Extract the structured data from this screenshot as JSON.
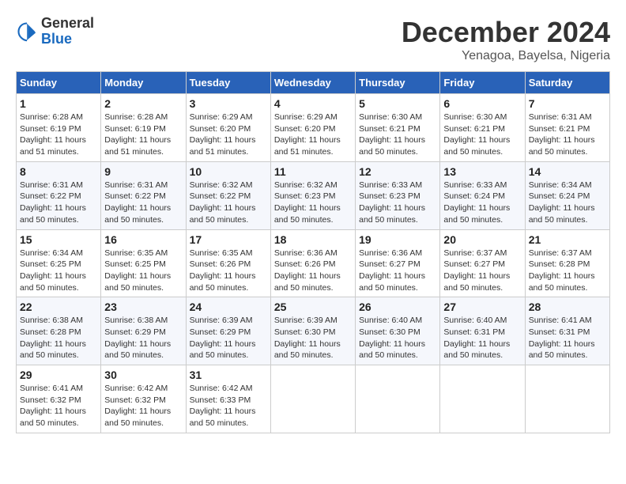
{
  "logo": {
    "general": "General",
    "blue": "Blue"
  },
  "title": "December 2024",
  "subtitle": "Yenagoa, Bayelsa, Nigeria",
  "days_of_week": [
    "Sunday",
    "Monday",
    "Tuesday",
    "Wednesday",
    "Thursday",
    "Friday",
    "Saturday"
  ],
  "weeks": [
    [
      {
        "day": "1",
        "sunrise": "6:28 AM",
        "sunset": "6:19 PM",
        "daylight": "11 hours and 51 minutes."
      },
      {
        "day": "2",
        "sunrise": "6:28 AM",
        "sunset": "6:19 PM",
        "daylight": "11 hours and 51 minutes."
      },
      {
        "day": "3",
        "sunrise": "6:29 AM",
        "sunset": "6:20 PM",
        "daylight": "11 hours and 51 minutes."
      },
      {
        "day": "4",
        "sunrise": "6:29 AM",
        "sunset": "6:20 PM",
        "daylight": "11 hours and 51 minutes."
      },
      {
        "day": "5",
        "sunrise": "6:30 AM",
        "sunset": "6:21 PM",
        "daylight": "11 hours and 50 minutes."
      },
      {
        "day": "6",
        "sunrise": "6:30 AM",
        "sunset": "6:21 PM",
        "daylight": "11 hours and 50 minutes."
      },
      {
        "day": "7",
        "sunrise": "6:31 AM",
        "sunset": "6:21 PM",
        "daylight": "11 hours and 50 minutes."
      }
    ],
    [
      {
        "day": "8",
        "sunrise": "6:31 AM",
        "sunset": "6:22 PM",
        "daylight": "11 hours and 50 minutes."
      },
      {
        "day": "9",
        "sunrise": "6:31 AM",
        "sunset": "6:22 PM",
        "daylight": "11 hours and 50 minutes."
      },
      {
        "day": "10",
        "sunrise": "6:32 AM",
        "sunset": "6:22 PM",
        "daylight": "11 hours and 50 minutes."
      },
      {
        "day": "11",
        "sunrise": "6:32 AM",
        "sunset": "6:23 PM",
        "daylight": "11 hours and 50 minutes."
      },
      {
        "day": "12",
        "sunrise": "6:33 AM",
        "sunset": "6:23 PM",
        "daylight": "11 hours and 50 minutes."
      },
      {
        "day": "13",
        "sunrise": "6:33 AM",
        "sunset": "6:24 PM",
        "daylight": "11 hours and 50 minutes."
      },
      {
        "day": "14",
        "sunrise": "6:34 AM",
        "sunset": "6:24 PM",
        "daylight": "11 hours and 50 minutes."
      }
    ],
    [
      {
        "day": "15",
        "sunrise": "6:34 AM",
        "sunset": "6:25 PM",
        "daylight": "11 hours and 50 minutes."
      },
      {
        "day": "16",
        "sunrise": "6:35 AM",
        "sunset": "6:25 PM",
        "daylight": "11 hours and 50 minutes."
      },
      {
        "day": "17",
        "sunrise": "6:35 AM",
        "sunset": "6:26 PM",
        "daylight": "11 hours and 50 minutes."
      },
      {
        "day": "18",
        "sunrise": "6:36 AM",
        "sunset": "6:26 PM",
        "daylight": "11 hours and 50 minutes."
      },
      {
        "day": "19",
        "sunrise": "6:36 AM",
        "sunset": "6:27 PM",
        "daylight": "11 hours and 50 minutes."
      },
      {
        "day": "20",
        "sunrise": "6:37 AM",
        "sunset": "6:27 PM",
        "daylight": "11 hours and 50 minutes."
      },
      {
        "day": "21",
        "sunrise": "6:37 AM",
        "sunset": "6:28 PM",
        "daylight": "11 hours and 50 minutes."
      }
    ],
    [
      {
        "day": "22",
        "sunrise": "6:38 AM",
        "sunset": "6:28 PM",
        "daylight": "11 hours and 50 minutes."
      },
      {
        "day": "23",
        "sunrise": "6:38 AM",
        "sunset": "6:29 PM",
        "daylight": "11 hours and 50 minutes."
      },
      {
        "day": "24",
        "sunrise": "6:39 AM",
        "sunset": "6:29 PM",
        "daylight": "11 hours and 50 minutes."
      },
      {
        "day": "25",
        "sunrise": "6:39 AM",
        "sunset": "6:30 PM",
        "daylight": "11 hours and 50 minutes."
      },
      {
        "day": "26",
        "sunrise": "6:40 AM",
        "sunset": "6:30 PM",
        "daylight": "11 hours and 50 minutes."
      },
      {
        "day": "27",
        "sunrise": "6:40 AM",
        "sunset": "6:31 PM",
        "daylight": "11 hours and 50 minutes."
      },
      {
        "day": "28",
        "sunrise": "6:41 AM",
        "sunset": "6:31 PM",
        "daylight": "11 hours and 50 minutes."
      }
    ],
    [
      {
        "day": "29",
        "sunrise": "6:41 AM",
        "sunset": "6:32 PM",
        "daylight": "11 hours and 50 minutes."
      },
      {
        "day": "30",
        "sunrise": "6:42 AM",
        "sunset": "6:32 PM",
        "daylight": "11 hours and 50 minutes."
      },
      {
        "day": "31",
        "sunrise": "6:42 AM",
        "sunset": "6:33 PM",
        "daylight": "11 hours and 50 minutes."
      },
      null,
      null,
      null,
      null
    ]
  ]
}
